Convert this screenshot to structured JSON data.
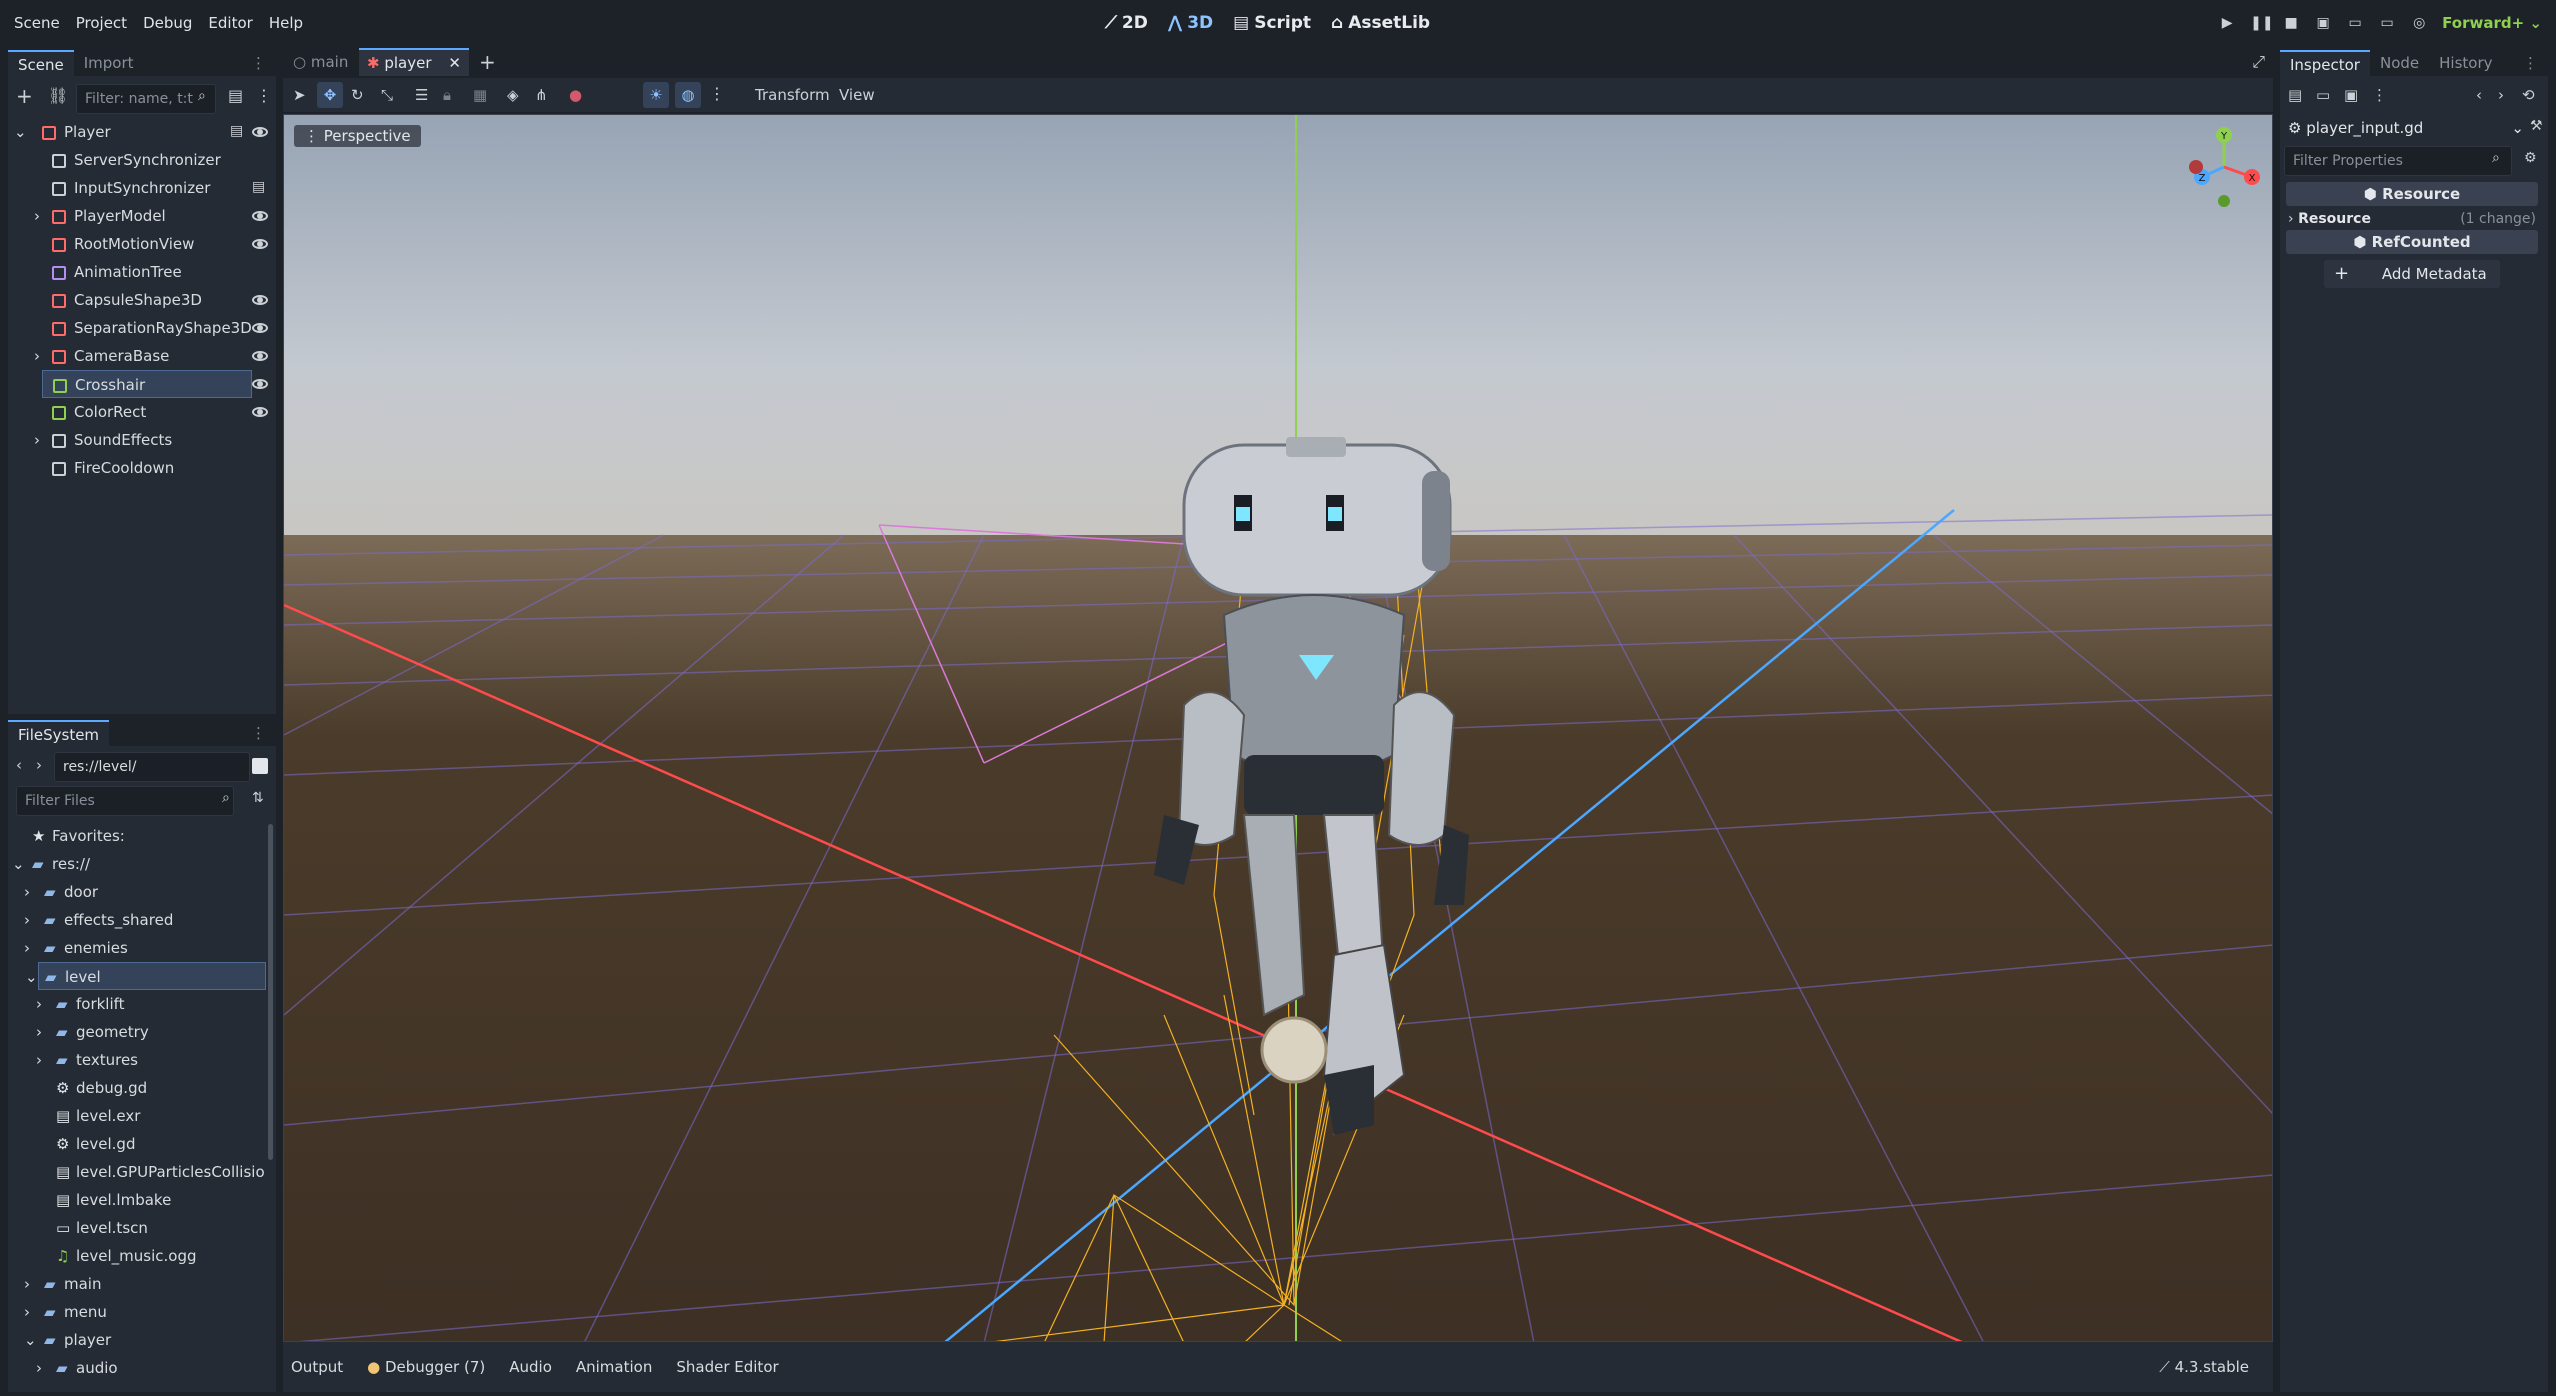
{
  "menu": [
    "Scene",
    "Project",
    "Debug",
    "Editor",
    "Help"
  ],
  "modes": [
    {
      "label": "2D",
      "icon": "2d-icon"
    },
    {
      "label": "3D",
      "icon": "3d-icon",
      "active": true
    },
    {
      "label": "Script",
      "icon": "script-icon"
    },
    {
      "label": "AssetLib",
      "icon": "assetlib-icon"
    }
  ],
  "renderer": "Forward+",
  "scene_dock": {
    "tabs": [
      "Scene",
      "Import"
    ],
    "filter_placeholder": "Filter: name, t:t",
    "nodes": [
      {
        "label": "Player",
        "color": "#ff6b6b",
        "depth": 0,
        "expand": "v"
      },
      {
        "label": "ServerSynchronizer",
        "color": "#cdd1d6",
        "depth": 1
      },
      {
        "label": "InputSynchronizer",
        "color": "#cdd1d6",
        "depth": 1
      },
      {
        "label": "PlayerModel",
        "color": "#ff6b6b",
        "depth": 1,
        "expand": ">"
      },
      {
        "label": "RootMotionView",
        "color": "#ff6b6b",
        "depth": 1
      },
      {
        "label": "AnimationTree",
        "color": "#b48ef0",
        "depth": 1
      },
      {
        "label": "CapsuleShape3D",
        "color": "#ff6b6b",
        "depth": 1
      },
      {
        "label": "SeparationRayShape3D",
        "color": "#ff6b6b",
        "depth": 1
      },
      {
        "label": "CameraBase",
        "color": "#ff6b6b",
        "depth": 1,
        "expand": ">"
      },
      {
        "label": "Crosshair",
        "color": "#8fd14f",
        "depth": 1,
        "selected": true
      },
      {
        "label": "ColorRect",
        "color": "#8fd14f",
        "depth": 1
      },
      {
        "label": "SoundEffects",
        "color": "#cdd1d6",
        "depth": 1,
        "expand": ">"
      },
      {
        "label": "FireCooldown",
        "color": "#cdd1d6",
        "depth": 1
      }
    ]
  },
  "filesystem": {
    "tab": "FileSystem",
    "path": "res://level/",
    "filter_placeholder": "Filter Files",
    "items": [
      {
        "label": "Favorites:",
        "type": "star",
        "depth": 0
      },
      {
        "label": "res://",
        "type": "folder",
        "depth": 0,
        "expand": "v"
      },
      {
        "label": "door",
        "type": "folder",
        "depth": 1,
        "expand": ">"
      },
      {
        "label": "effects_shared",
        "type": "folder",
        "depth": 1,
        "expand": ">"
      },
      {
        "label": "enemies",
        "type": "folder",
        "depth": 1,
        "expand": ">"
      },
      {
        "label": "level",
        "type": "folder",
        "depth": 1,
        "expand": "v",
        "selected": true
      },
      {
        "label": "forklift",
        "type": "folder",
        "depth": 2,
        "expand": ">"
      },
      {
        "label": "geometry",
        "type": "folder",
        "depth": 2,
        "expand": ">"
      },
      {
        "label": "textures",
        "type": "folder",
        "depth": 2,
        "expand": ">"
      },
      {
        "label": "debug.gd",
        "type": "gear",
        "depth": 2
      },
      {
        "label": "level.exr",
        "type": "file",
        "depth": 2
      },
      {
        "label": "level.gd",
        "type": "gear",
        "depth": 2
      },
      {
        "label": "level.GPUParticlesCollisio...",
        "type": "file",
        "depth": 2
      },
      {
        "label": "level.lmbake",
        "type": "file",
        "depth": 2
      },
      {
        "label": "level.tscn",
        "type": "scene",
        "depth": 2
      },
      {
        "label": "level_music.ogg",
        "type": "audio",
        "depth": 2
      },
      {
        "label": "main",
        "type": "folder",
        "depth": 1,
        "expand": ">"
      },
      {
        "label": "menu",
        "type": "folder",
        "depth": 1,
        "expand": ">"
      },
      {
        "label": "player",
        "type": "folder",
        "depth": 1,
        "expand": "v"
      },
      {
        "label": "audio",
        "type": "folder",
        "depth": 2,
        "expand": ">"
      }
    ]
  },
  "editor_tabs": [
    {
      "label": "main",
      "active": false
    },
    {
      "label": "player",
      "active": true
    }
  ],
  "viewport_toolbar": {
    "transform": "Transform",
    "view": "View"
  },
  "viewport": {
    "mode": "Perspective",
    "gizmo": {
      "y": "Y",
      "x": "X",
      "z": "Z"
    }
  },
  "bottom": {
    "tabs": [
      "Output",
      "Debugger (7)",
      "Audio",
      "Animation",
      "Shader Editor"
    ],
    "version": "4.3.stable"
  },
  "inspector": {
    "tabs": [
      "Inspector",
      "Node",
      "History"
    ],
    "resource_name": "player_input.gd",
    "filter_placeholder": "Filter Properties",
    "section1": "Resource",
    "row_label": "Resource",
    "row_value": "(1 change)",
    "section2": "RefCounted",
    "add_metadata": "Add Metadata"
  }
}
